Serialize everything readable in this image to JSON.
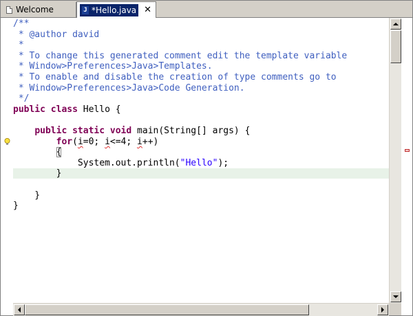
{
  "tabs": [
    {
      "label": "Welcome",
      "icon": "document-icon",
      "active": false
    },
    {
      "label": "*Hello.java",
      "icon": "java-file-icon",
      "active": true,
      "close": "✕"
    }
  ],
  "code": {
    "lines": [
      {
        "segments": [
          {
            "t": "/**",
            "c": "comment"
          }
        ]
      },
      {
        "segments": [
          {
            "t": " * @author david",
            "c": "comment"
          }
        ]
      },
      {
        "segments": [
          {
            "t": " *",
            "c": "comment"
          }
        ]
      },
      {
        "segments": [
          {
            "t": " * To change this generated comment edit the template variable ",
            "c": "comment"
          }
        ]
      },
      {
        "segments": [
          {
            "t": " * Window>Preferences>Java>Templates.",
            "c": "comment"
          }
        ]
      },
      {
        "segments": [
          {
            "t": " * To enable and disable the creation of type comments go to",
            "c": "comment"
          }
        ]
      },
      {
        "segments": [
          {
            "t": " * Window>Preferences>Java>Code Generation.",
            "c": "comment"
          }
        ]
      },
      {
        "segments": [
          {
            "t": " */",
            "c": "comment"
          }
        ]
      },
      {
        "segments": [
          {
            "t": "public",
            "c": "kw"
          },
          {
            "t": " ",
            "c": "plain"
          },
          {
            "t": "class",
            "c": "kw"
          },
          {
            "t": " Hello {",
            "c": "plain"
          }
        ]
      },
      {
        "segments": [
          {
            "t": "",
            "c": "plain"
          }
        ]
      },
      {
        "segments": [
          {
            "t": "    ",
            "c": "plain"
          },
          {
            "t": "public",
            "c": "kw"
          },
          {
            "t": " ",
            "c": "plain"
          },
          {
            "t": "static",
            "c": "kw"
          },
          {
            "t": " ",
            "c": "plain"
          },
          {
            "t": "void",
            "c": "kw"
          },
          {
            "t": " main(String[] args) {",
            "c": "plain"
          }
        ]
      },
      {
        "segments": [
          {
            "t": "        ",
            "c": "plain"
          },
          {
            "t": "for",
            "c": "kw"
          },
          {
            "t": "(",
            "c": "plain"
          },
          {
            "t": "i",
            "c": "plain squig"
          },
          {
            "t": "=0; ",
            "c": "plain"
          },
          {
            "t": "i",
            "c": "plain squig"
          },
          {
            "t": "<=4; ",
            "c": "plain"
          },
          {
            "t": "i",
            "c": "plain squig"
          },
          {
            "t": "++)",
            "c": "plain"
          }
        ]
      },
      {
        "segments": [
          {
            "t": "        ",
            "c": "plain"
          },
          {
            "t": "{",
            "c": "plain box"
          }
        ]
      },
      {
        "segments": [
          {
            "t": "            System.out.println(",
            "c": "plain"
          },
          {
            "t": "\"Hello\"",
            "c": "str"
          },
          {
            "t": ");",
            "c": "plain"
          }
        ]
      },
      {
        "segments": [
          {
            "t": "        }",
            "c": "plain"
          }
        ],
        "current": true
      },
      {
        "segments": [
          {
            "t": "",
            "c": "plain"
          }
        ]
      },
      {
        "segments": [
          {
            "t": "    }",
            "c": "plain"
          }
        ]
      },
      {
        "segments": [
          {
            "t": "}",
            "c": "plain"
          }
        ]
      }
    ]
  },
  "colors": {
    "comment": "#3f5fbf",
    "keyword": "#7f0055",
    "string": "#2a00ff",
    "current_line": "#e8f2e8",
    "tab_active": "#0a246a"
  },
  "icons": {
    "quick_fix": "lightbulb-icon",
    "error_marker": "error-marker-icon"
  }
}
